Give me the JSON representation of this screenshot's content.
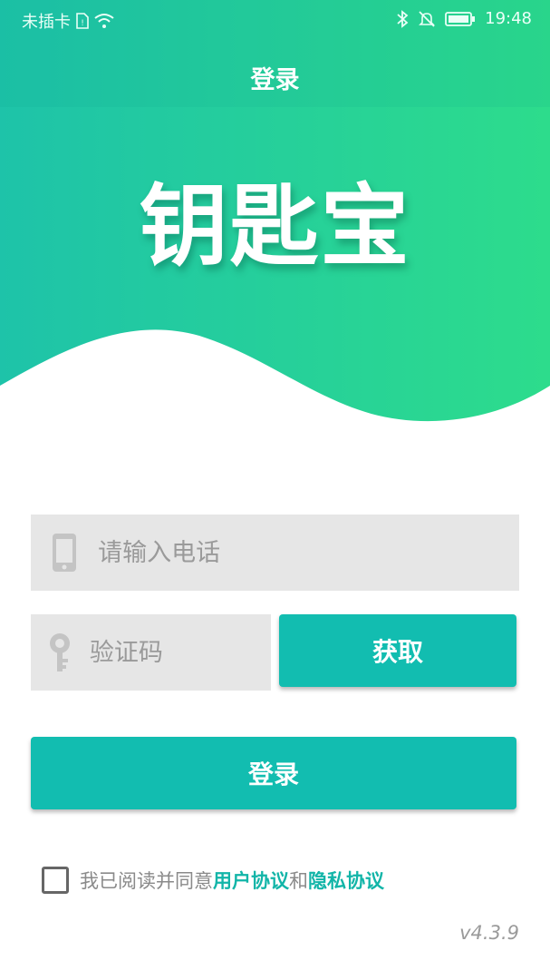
{
  "status_bar": {
    "carrier": "未插卡",
    "time": "19:48",
    "icons": [
      "sim-icon",
      "wifi-icon",
      "bluetooth-icon",
      "mute-icon",
      "battery-icon"
    ]
  },
  "header": {
    "title": "登录",
    "logo_text": "钥匙宝",
    "gradient_start": "#1ec3a9",
    "gradient_end": "#2ddc8c"
  },
  "form": {
    "phone_placeholder": "请输入电话",
    "code_placeholder": "验证码",
    "get_code_label": "获取",
    "login_label": "登录",
    "accent_color": "#12bdb0"
  },
  "agreement": {
    "checked": false,
    "prefix": "我已阅读并同意",
    "user_agreement": "用户协议",
    "conjunction": "和",
    "privacy_agreement": "隐私协议"
  },
  "version": "v4.3.9"
}
